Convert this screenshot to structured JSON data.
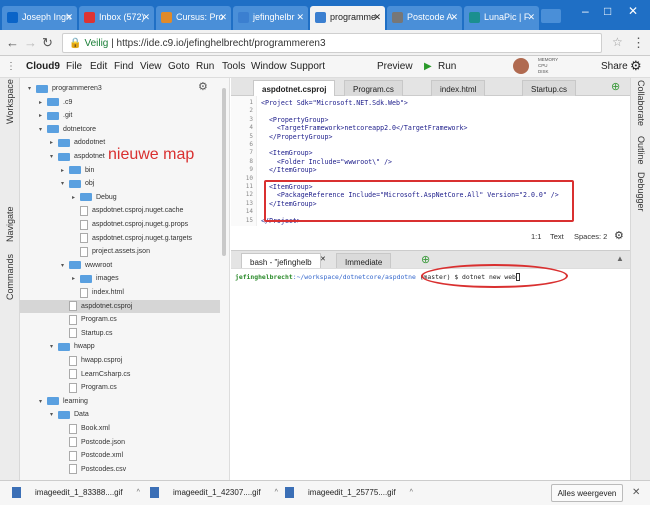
{
  "browser": {
    "tabs": [
      {
        "label": "Joseph Ingh",
        "icon": "outlook-icon",
        "color": "#0a64c8"
      },
      {
        "label": "Inbox (572)",
        "icon": "gmail-icon",
        "color": "#d33"
      },
      {
        "label": "Cursus: Pro",
        "icon": "cursus-icon",
        "color": "#e08a2a"
      },
      {
        "label": "jefinghelbr",
        "icon": "c9-icon",
        "color": "#3b7fd0"
      },
      {
        "label": "programme",
        "icon": "c9-icon",
        "color": "#3b7fd0"
      },
      {
        "label": "Postcode A",
        "icon": "page-icon",
        "color": "#777"
      },
      {
        "label": "LunaPic | F",
        "icon": "lunapic-icon",
        "color": "#1b8f8f"
      }
    ],
    "address": {
      "secure_label": "Veilig",
      "url": "https://ide.c9.io/jefinghelbrecht/programmeren3"
    }
  },
  "ide": {
    "brand": "Cloud9",
    "menu": [
      "File",
      "Edit",
      "Find",
      "View",
      "Goto",
      "Run",
      "Tools",
      "Window",
      "Support"
    ],
    "preview": "Preview",
    "run": "Run",
    "share": "Share",
    "mem": [
      "MEMORY",
      "CPU",
      "DISK"
    ],
    "left_panels": [
      "Workspace",
      "Navigate",
      "Commands"
    ],
    "right_panels": [
      "Collaborate",
      "Outline",
      "Debugger"
    ]
  },
  "tree": [
    {
      "label": "programmeren3",
      "type": "folder",
      "depth": 0,
      "open": true
    },
    {
      "label": ".c9",
      "type": "folder",
      "depth": 1,
      "open": false
    },
    {
      "label": ".git",
      "type": "folder",
      "depth": 1,
      "open": false
    },
    {
      "label": "dotnetcore",
      "type": "folder",
      "depth": 1,
      "open": true
    },
    {
      "label": "adodotnet",
      "type": "folder",
      "depth": 2,
      "open": false
    },
    {
      "label": "aspdotnet",
      "type": "folder",
      "depth": 2,
      "open": true
    },
    {
      "label": "bin",
      "type": "folder",
      "depth": 3,
      "open": false
    },
    {
      "label": "obj",
      "type": "folder",
      "depth": 3,
      "open": true
    },
    {
      "label": "Debug",
      "type": "folder",
      "depth": 4,
      "open": false
    },
    {
      "label": "aspdotnet.csproj.nuget.cache",
      "type": "file",
      "depth": 4
    },
    {
      "label": "aspdotnet.csproj.nuget.g.props",
      "type": "file",
      "depth": 4
    },
    {
      "label": "aspdotnet.csproj.nuget.g.targets",
      "type": "file",
      "depth": 4
    },
    {
      "label": "project.assets.json",
      "type": "file",
      "depth": 4
    },
    {
      "label": "wwwroot",
      "type": "folder",
      "depth": 3,
      "open": true
    },
    {
      "label": "images",
      "type": "folder",
      "depth": 4,
      "open": false
    },
    {
      "label": "index.html",
      "type": "file",
      "depth": 4
    },
    {
      "label": "aspdotnet.csproj",
      "type": "file",
      "depth": 3,
      "selected": true
    },
    {
      "label": "Program.cs",
      "type": "file",
      "depth": 3
    },
    {
      "label": "Startup.cs",
      "type": "file",
      "depth": 3
    },
    {
      "label": "hwapp",
      "type": "folder",
      "depth": 2,
      "open": true
    },
    {
      "label": "hwapp.csproj",
      "type": "file",
      "depth": 3
    },
    {
      "label": "LearnCsharp.cs",
      "type": "file",
      "depth": 3
    },
    {
      "label": "Program.cs",
      "type": "file",
      "depth": 3
    },
    {
      "label": "learning",
      "type": "folder",
      "depth": 1,
      "open": true
    },
    {
      "label": "Data",
      "type": "folder",
      "depth": 2,
      "open": true
    },
    {
      "label": "Book.xml",
      "type": "file",
      "depth": 3
    },
    {
      "label": "Postcode.json",
      "type": "file",
      "depth": 3
    },
    {
      "label": "Postcode.xml",
      "type": "file",
      "depth": 3
    },
    {
      "label": "Postcodes.csv",
      "type": "file",
      "depth": 3
    }
  ],
  "annotation": {
    "label": "nieuwe map",
    "color": "#d93030"
  },
  "editor": {
    "tabs": [
      "aspdotnet.csproj",
      "Program.cs",
      "index.html",
      "Startup.cs"
    ],
    "active_tab": 0,
    "lines": [
      "<Project Sdk=\"Microsoft.NET.Sdk.Web\">",
      "",
      "  <PropertyGroup>",
      "    <TargetFramework>netcoreapp2.0</TargetFramework>",
      "  </PropertyGroup>",
      "",
      "  <ItemGroup>",
      "    <Folder Include=\"wwwroot\\\" />",
      "  </ItemGroup>",
      "",
      "  <ItemGroup>",
      "    <PackageReference Include=\"Microsoft.AspNetCore.All\" Version=\"2.0.0\" />",
      "  </ItemGroup>",
      "",
      "</Project>"
    ],
    "status": {
      "position": "1:1",
      "mode": "Text",
      "spaces": "Spaces: 2"
    }
  },
  "terminal": {
    "tabs": [
      "bash - \"jefinghelb",
      "Immediate"
    ],
    "prompt_user": "jefinghelbrecht",
    "prompt_path": ":~/workspace/dotnetcore/aspdotne",
    "command": "(master) $ dotnet new web"
  },
  "downloads": {
    "items": [
      "imageedit_1_83388....gif",
      "imageedit_1_42307....gif",
      "imageedit_1_25775....gif"
    ],
    "show_all": "Alles weergeven"
  }
}
